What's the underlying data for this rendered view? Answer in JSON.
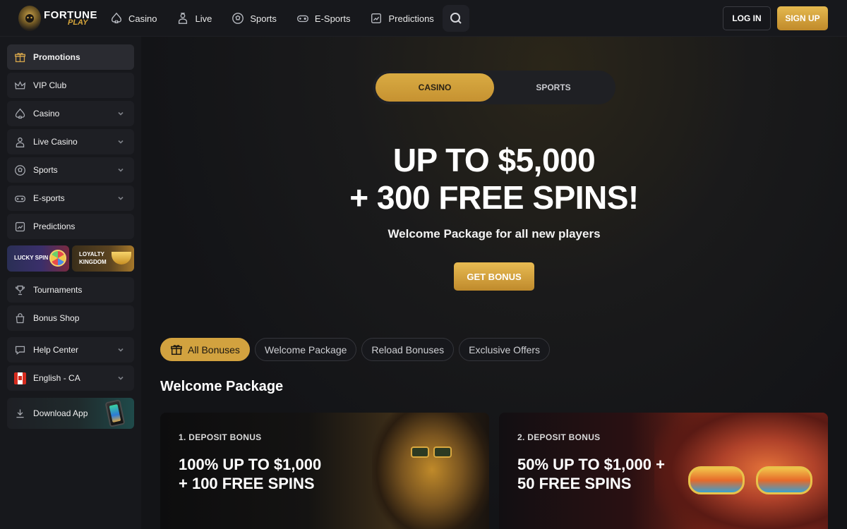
{
  "brand": {
    "line1": "FORTUNE",
    "line2": "PLAY",
    "accent_color": "#d9ab43"
  },
  "topnav": {
    "items": [
      {
        "label": "Casino",
        "icon": "spade-icon"
      },
      {
        "label": "Live",
        "icon": "dealer-icon"
      },
      {
        "label": "Sports",
        "icon": "soccer-ball-icon"
      },
      {
        "label": "E-Sports",
        "icon": "gamepad-icon"
      },
      {
        "label": "Predictions",
        "icon": "chart-icon"
      }
    ],
    "login_label": "LOG IN",
    "signup_label": "SIGN UP"
  },
  "sidebar": {
    "items": [
      {
        "label": "Promotions",
        "icon": "gift-icon",
        "active": true
      },
      {
        "label": "VIP Club",
        "icon": "crown-icon"
      },
      {
        "label": "Casino",
        "icon": "spade-icon",
        "expandable": true
      },
      {
        "label": "Live Casino",
        "icon": "dealer-icon",
        "expandable": true
      },
      {
        "label": "Sports",
        "icon": "soccer-ball-icon",
        "expandable": true
      },
      {
        "label": "E-sports",
        "icon": "gamepad-icon",
        "expandable": true
      },
      {
        "label": "Predictions",
        "icon": "chart-icon"
      }
    ],
    "tiles": {
      "lucky_spin": "LUCKY SPIN",
      "loyalty_line1": "LOYALTY",
      "loyalty_line2": "KINGDOM"
    },
    "items2": [
      {
        "label": "Tournaments",
        "icon": "trophy-icon"
      },
      {
        "label": "Bonus Shop",
        "icon": "shopping-bag-icon"
      }
    ],
    "help_center": "Help Center",
    "language": "English - CA",
    "download_app": "Download App"
  },
  "main": {
    "toggle": {
      "casino": "CASINO",
      "sports": "SPORTS",
      "selected": "CASINO"
    },
    "hero": {
      "line1": "UP TO $5,000",
      "line2": "+ 300 FREE SPINS!",
      "subtitle": "Welcome Package for all new players",
      "cta": "GET BONUS"
    },
    "filters": [
      "All Bonuses",
      "Welcome Package",
      "Reload Bonuses",
      "Exclusive Offers"
    ],
    "active_filter": "All Bonuses",
    "section_title": "Welcome Package",
    "cards": [
      {
        "label": "1. DEPOSIT BONUS",
        "title_line1": "100% UP TO $1,000",
        "title_line2": "+ 100 FREE SPINS"
      },
      {
        "label": "2. DEPOSIT BONUS",
        "title_line1": "50% UP TO $1,000 +",
        "title_line2": "50 FREE SPINS"
      }
    ]
  }
}
